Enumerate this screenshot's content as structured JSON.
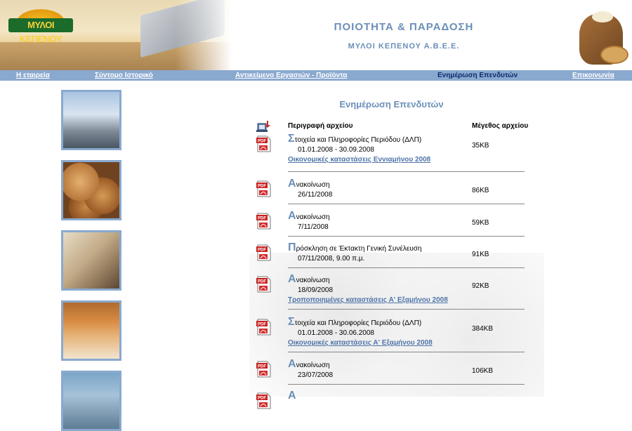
{
  "header": {
    "logo_text": "ΜΥΛΟΙ ΚΕΠΕΝΟΥ",
    "title": "ΠΟΙΟΤΗΤΑ & ΠΑΡΑΔΟΣΗ",
    "subtitle": "ΜΥΛΟΙ ΚΕΠΕΝΟΥ Α.Β.Ε.Ε."
  },
  "nav": {
    "items": [
      {
        "label": "Η εταιρεία",
        "active": false
      },
      {
        "label": "Σύντομο Ιστορικό",
        "active": false
      },
      {
        "label": "Αντικείμενο Εργασιών - Προϊόντα",
        "active": false
      },
      {
        "label": "Ενημέρωση Επενδυτών",
        "active": true
      },
      {
        "label": "Επικοινωνία",
        "active": false
      }
    ]
  },
  "content": {
    "title": "Ενημέρωση Επενδυτών",
    "columns": {
      "description": "Περιγραφή αρχείου",
      "size": "Μέγεθος αρχείου"
    },
    "rows": [
      {
        "initial": "Σ",
        "rest": "τοιχεία και Πληροφορίες Περιόδου (ΔΛΠ)",
        "date": "01.01.2008 - 30.09.2008",
        "link": "Οικονομικές καταστάσεις Εννιαμήνου 2008",
        "size": "35KB"
      },
      {
        "initial": "Α",
        "rest": "νακοίνωση",
        "date": "26/11/2008",
        "link": "",
        "size": "86KB"
      },
      {
        "initial": "Α",
        "rest": "νακοίνωση",
        "date": "7/11/2008",
        "link": "",
        "size": "59KB"
      },
      {
        "initial": "Π",
        "rest": "ρόσκληση σε Έκτακτη Γενική Συνέλευση",
        "date": "07/11/2008, 9.00 π.μ.",
        "link": "",
        "size": "91KB"
      },
      {
        "initial": "Α",
        "rest": "νακοίνωση",
        "date": "18/09/2008",
        "link": "Τροποποιημένες καταστάσεις Α' Εξαμήνου 2008",
        "size": "92KB"
      },
      {
        "initial": "Σ",
        "rest": "τοιχεία και Πληροφορίες Περιόδου (ΔΛΠ)",
        "date": "01.01.2008 - 30.06.2008",
        "link": "Οικονομικές καταστάσεις Α' Εξαμήνου 2008",
        "size": "384KB"
      },
      {
        "initial": "Α",
        "rest": "νακοίνωση",
        "date": "23/07/2008",
        "link": "",
        "size": "106KB"
      },
      {
        "initial": "Α",
        "rest": "",
        "date": "",
        "link": "",
        "size": ""
      }
    ]
  },
  "icons": {
    "pdf": "pdf-file-icon",
    "download": "download-icon"
  },
  "colors": {
    "accent": "#6b8fb8",
    "nav_bg": "#8aa9cf",
    "nav_active": "#0b2b6e",
    "link": "#4f74a8"
  }
}
